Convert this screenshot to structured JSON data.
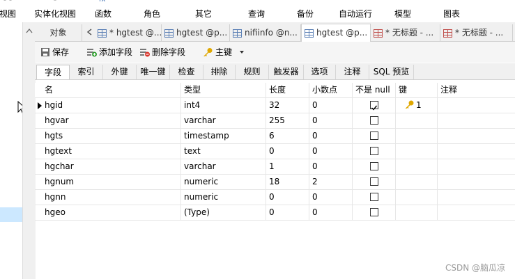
{
  "main_toolbar": {
    "items": [
      {
        "label": "视图"
      },
      {
        "label": "实体化视图"
      },
      {
        "label": "函数"
      },
      {
        "label": "角色"
      },
      {
        "label": "其它"
      },
      {
        "label": "查询"
      },
      {
        "label": "备份"
      },
      {
        "label": "自动运行"
      },
      {
        "label": "模型"
      },
      {
        "label": "图表"
      }
    ]
  },
  "doc_tabs": {
    "objects_label": "对象",
    "tabs": [
      {
        "label": "* hgtest @..."
      },
      {
        "label": "hgtest @p..."
      },
      {
        "label": "nifiinfo @n..."
      },
      {
        "label": "hgtest @p..."
      },
      {
        "label": "* 无标题 - ..."
      },
      {
        "label": "* 无标题 - ..."
      }
    ]
  },
  "actions": {
    "save": "保存",
    "add_field": "添加字段",
    "delete_field": "删除字段",
    "primary_key": "主键"
  },
  "sub_tabs": [
    "字段",
    "索引",
    "外键",
    "唯一键",
    "检查",
    "排除",
    "规则",
    "触发器",
    "选项",
    "注释",
    "SQL 预览"
  ],
  "columns": [
    "名",
    "类型",
    "长度",
    "小数点",
    "不是 null",
    "键",
    "注释"
  ],
  "rows": [
    {
      "name": "hgid",
      "type": "int4",
      "length": "32",
      "scale": "0",
      "not_null": true,
      "key": "1"
    },
    {
      "name": "hgvar",
      "type": "varchar",
      "length": "255",
      "scale": "0",
      "not_null": false,
      "key": ""
    },
    {
      "name": "hgts",
      "type": "timestamp",
      "length": "6",
      "scale": "0",
      "not_null": false,
      "key": ""
    },
    {
      "name": "hgtext",
      "type": "text",
      "length": "0",
      "scale": "0",
      "not_null": false,
      "key": ""
    },
    {
      "name": "hgchar",
      "type": "varchar",
      "length": "1",
      "scale": "0",
      "not_null": false,
      "key": ""
    },
    {
      "name": "hgnum",
      "type": "numeric",
      "length": "18",
      "scale": "2",
      "not_null": false,
      "key": ""
    },
    {
      "name": "hgnn",
      "type": "numeric",
      "length": "0",
      "scale": "0",
      "not_null": false,
      "key": ""
    },
    {
      "name": "hgeo",
      "type": "(Type)",
      "length": "0",
      "scale": "0",
      "not_null": false,
      "key": ""
    }
  ],
  "watermark": "CSDN @脑瓜凉",
  "colors": {
    "accent": "#0078d7",
    "selection": "#cce8ff",
    "key_gold": "#e0a800"
  }
}
